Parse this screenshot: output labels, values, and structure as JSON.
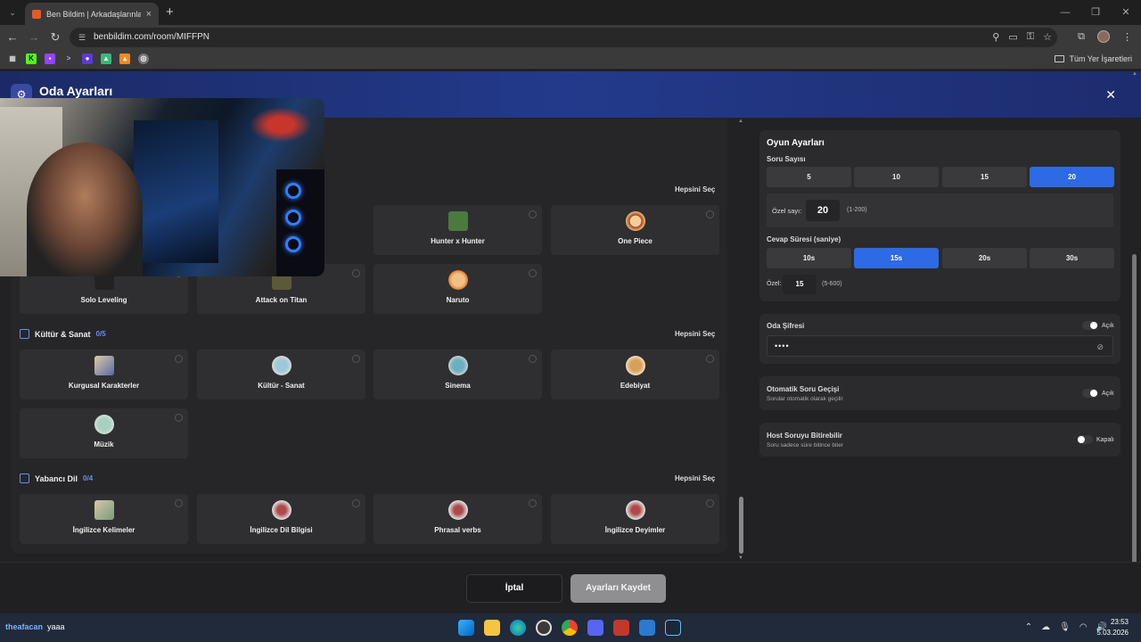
{
  "browser": {
    "tab_title": "Ben Bildim | Arkadaşlarınla Onl",
    "url": "benbildim.com/room/MIFFPN",
    "bookmarks_all": "Tüm Yer İşaretleri"
  },
  "header": {
    "title": "Oda Ayarları"
  },
  "sections": {
    "top": {
      "select_all": "Hepsini Seç"
    },
    "kultur": {
      "title": "Kültür & Sanat",
      "count": "0/5",
      "select_all": "Hepsini Seç"
    },
    "yabanci": {
      "title": "Yabancı Dil",
      "count": "0/4",
      "select_all": "Hepsini Seç"
    }
  },
  "cards": {
    "hunter": "Hunter x Hunter",
    "onepiece": "One Piece",
    "solo": "Solo Leveling",
    "attack": "Attack on Titan",
    "naruto": "Naruto",
    "kurgusal": "Kurgusal Karakterler",
    "kultur_sanat": "Kültür - Sanat",
    "sinema": "Sinema",
    "edebiyat": "Edebiyat",
    "muzik": "Müzik",
    "ing_kelime": "İngilizce Kelimeler",
    "ing_dil": "İngilizce Dil Bilgisi",
    "phrasal": "Phrasal verbs",
    "ing_deyim": "İngilizce Deyimler"
  },
  "game_settings": {
    "title": "Oyun Ayarları",
    "question_count_label": "Soru Sayısı",
    "question_counts": [
      "5",
      "10",
      "15",
      "20"
    ],
    "question_count_selected": "20",
    "custom_count_label": "Özel sayı:",
    "custom_count_value": "20",
    "custom_count_hint": "(1-200)",
    "answer_time_label": "Cevap Süresi (saniye)",
    "answer_times": [
      "10s",
      "15s",
      "20s",
      "30s"
    ],
    "answer_time_selected": "15s",
    "custom_time_label": "Özel:",
    "custom_time_value": "15",
    "custom_time_hint": "(5-600)"
  },
  "room_password": {
    "title": "Oda Şifresi",
    "state": "Açık",
    "value": "••••"
  },
  "auto_next": {
    "title": "Otomatik Soru Geçişi",
    "desc": "Sorular otomatik olarak geçilir",
    "state": "Açık"
  },
  "host_finish": {
    "title": "Host Soruyu Bitirebilir",
    "desc": "Soru sadece süre bitince biter",
    "state": "Kapalı"
  },
  "footer": {
    "cancel": "İptal",
    "save": "Ayarları Kaydet"
  },
  "taskbar": {
    "user": "theafacan",
    "message": "yaaa",
    "time": "23:53",
    "date": "5.03.2026"
  },
  "colors": {
    "accent": "#2d6ae3",
    "header": "#233a8c"
  }
}
